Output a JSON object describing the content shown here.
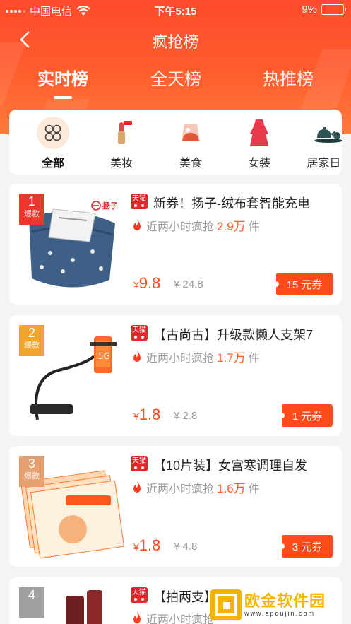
{
  "status_bar": {
    "carrier": "中国电信",
    "time": "下午5:15",
    "battery": "9%"
  },
  "header": {
    "title": "疯抢榜"
  },
  "tabs": [
    {
      "label": "实时榜",
      "active": true
    },
    {
      "label": "全天榜",
      "active": false
    },
    {
      "label": "热推榜",
      "active": false
    }
  ],
  "categories": [
    {
      "label": "全部",
      "active": true
    },
    {
      "label": "美妆",
      "active": false
    },
    {
      "label": "美食",
      "active": false
    },
    {
      "label": "女装",
      "active": false
    },
    {
      "label": "居家日...",
      "active": false
    }
  ],
  "products": [
    {
      "rank": "1",
      "rank_tag": "爆款",
      "rank_color": "#e8382e",
      "platform": "天猫",
      "brand_logo": "扬子",
      "title": "新券！扬子-绒布套智能充电",
      "sales_prefix": "近两小时疯抢",
      "sales_count": "2.9万",
      "sales_suffix": "件",
      "currency": "¥",
      "price": "9.8",
      "original_price": "¥ 24.8",
      "coupon": "15 元券"
    },
    {
      "rank": "2",
      "rank_tag": "爆款",
      "rank_color": "#f0a52e",
      "platform": "天猫",
      "title": "【古尚古】升级款懒人支架7",
      "sales_prefix": "近两小时疯抢",
      "sales_count": "1.7万",
      "sales_suffix": "件",
      "currency": "¥",
      "price": "1.8",
      "original_price": "¥ 2.8",
      "coupon": "1 元券"
    },
    {
      "rank": "3",
      "rank_tag": "爆款",
      "rank_color": "#e6a070",
      "platform": "天猫",
      "title": "【10片装】女宫寒调理自发",
      "sales_prefix": "近两小时疯抢",
      "sales_count": "1.6万",
      "sales_suffix": "件",
      "currency": "¥",
      "price": "1.8",
      "original_price": "¥ 4.8",
      "coupon": "3 元券"
    },
    {
      "rank": "4",
      "rank_tag": "",
      "rank_color": "#a0a0a0",
      "platform": "天猫",
      "title": "【拍两支】",
      "sales_prefix": "近两小时疯抢",
      "sales_count": "",
      "sales_suffix": ""
    }
  ],
  "watermark": {
    "name": "欧金软件园",
    "url": "www.apoujin.com"
  },
  "colors": {
    "accent": "#ff4a1a",
    "header": "#ff5e2e"
  }
}
